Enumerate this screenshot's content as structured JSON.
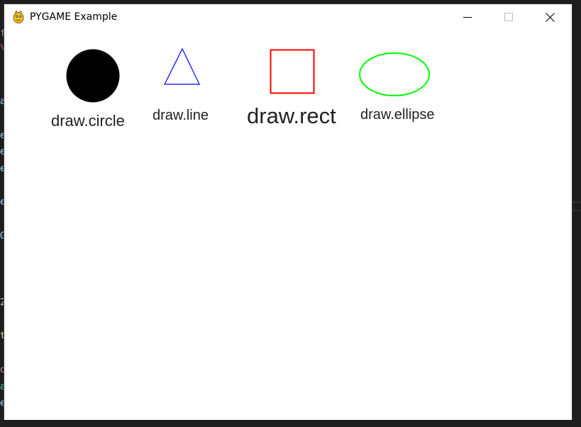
{
  "window": {
    "title": "PYGAME Example",
    "controls": {
      "minimize": "minimize",
      "maximize": "maximize",
      "close": "close"
    }
  },
  "canvas": {
    "background": "#ffffff",
    "items": [
      {
        "shape": "circle",
        "label": "draw.circle",
        "color": "#000000"
      },
      {
        "shape": "triangle",
        "label": "draw.line",
        "color": "#0000ff"
      },
      {
        "shape": "square",
        "label": "draw.rect",
        "color": "#ff0000"
      },
      {
        "shape": "ellipse",
        "label": "draw.ellipse",
        "color": "#00ff00"
      }
    ]
  },
  "colors": {
    "background_editor": "#1e1e1e",
    "label_text": "#222222"
  },
  "background_editor": {
    "glyphs": [
      "f",
      "\\",
      "a",
      "e",
      "e",
      "e",
      "e",
      "G",
      "2",
      "t",
      "o",
      "a",
      "e"
    ]
  }
}
